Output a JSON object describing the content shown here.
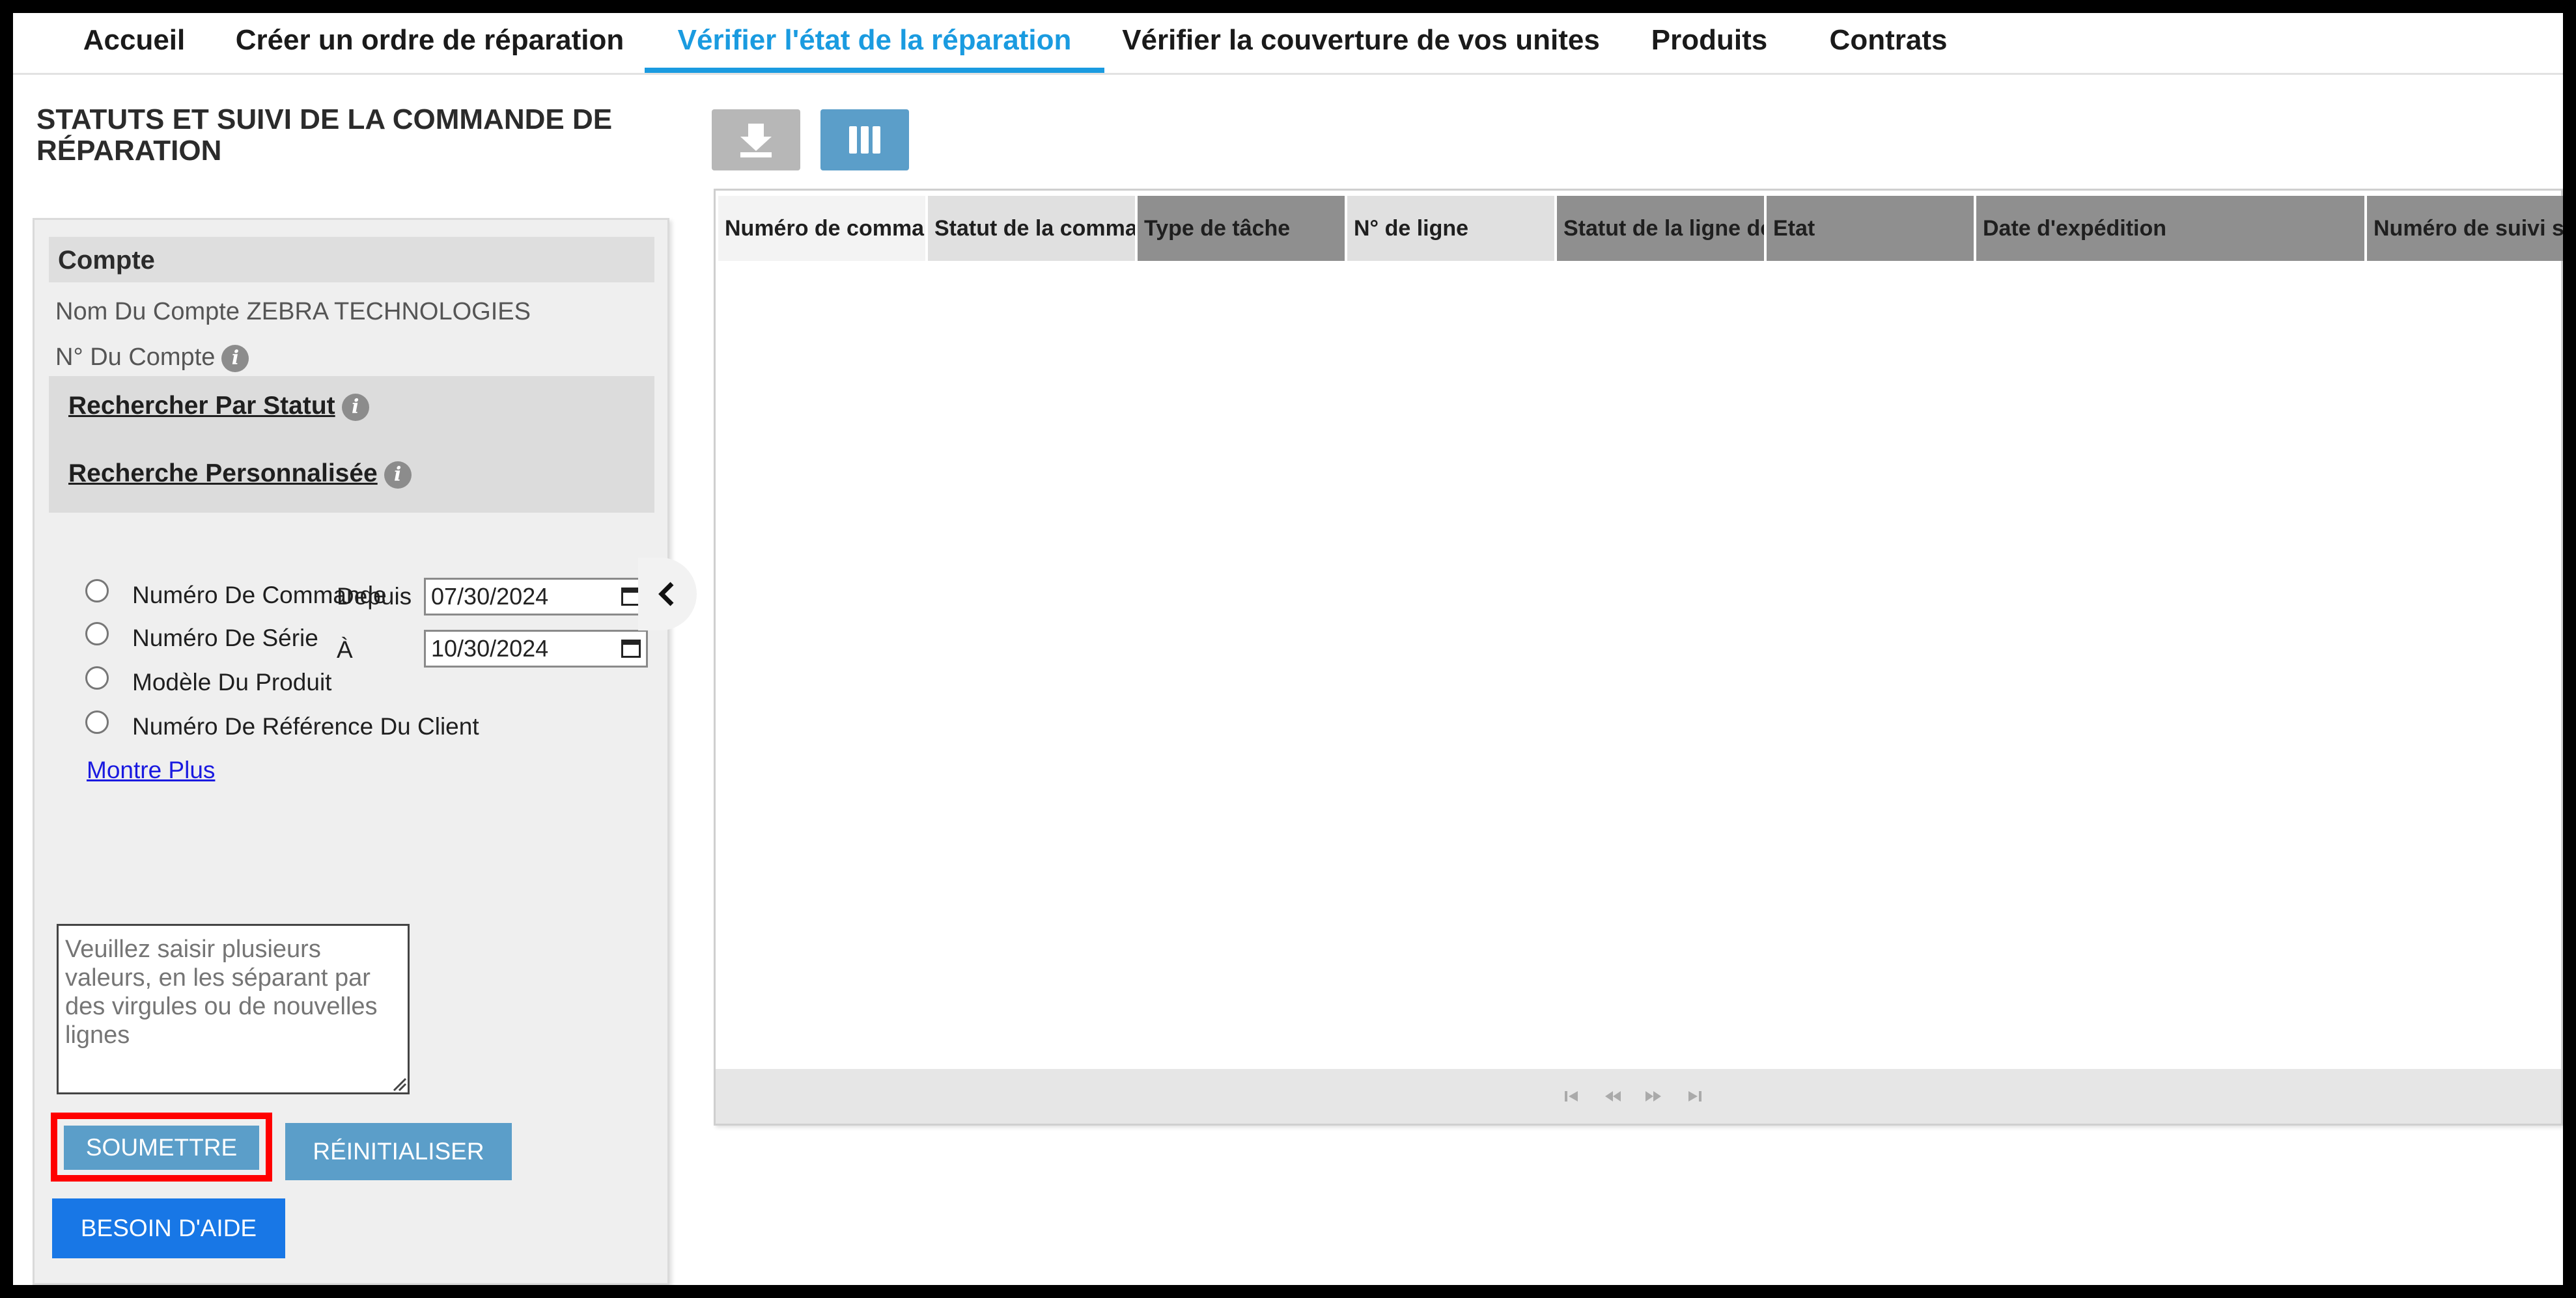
{
  "nav": {
    "tabs": [
      {
        "label": "Accueil"
      },
      {
        "label": "Créer un ordre de réparation"
      },
      {
        "label": "Vérifier l'état de la réparation",
        "active": true
      },
      {
        "label": "Vérifier la couverture de vos unites"
      },
      {
        "label": "Produits"
      },
      {
        "label": "Contrats"
      }
    ]
  },
  "page": {
    "title_line1": "STATUTS ET SUIVI DE LA COMMANDE DE",
    "title_line2": "RÉPARATION"
  },
  "account": {
    "section_label": "Compte",
    "name_label": "Nom Du Compte",
    "name_value": "ZEBRA TECHNOLOGIES",
    "number_label": "N° Du Compte"
  },
  "search": {
    "by_status_label": "Rechercher Par Statut",
    "custom_label": "Recherche Personnalisée",
    "radio_options": [
      {
        "label": "Numéro De Commande"
      },
      {
        "label": "Numéro De Série"
      },
      {
        "label": "Modèle Du Produit"
      },
      {
        "label": "Numéro De Référence Du Client"
      }
    ],
    "from_label": "Depuis",
    "from_value": "07/30/2024",
    "to_label": "À",
    "to_value": "10/30/2024",
    "show_more_label": "Montre Plus",
    "values_placeholder": "Veuillez saisir plusieurs valeurs, en les séparant par des virgules ou de nouvelles lignes"
  },
  "buttons": {
    "submit": "SOUMETTRE",
    "reset": "RÉINITIALISER",
    "help": "BESOIN D'AIDE"
  },
  "toolbar": {
    "download_icon": "download-icon",
    "columns_icon": "columns-icon"
  },
  "grid": {
    "columns": [
      {
        "label": "Numéro de commande"
      },
      {
        "label": "Statut de la commande"
      },
      {
        "label": "Type de tâche"
      },
      {
        "label": "N° de ligne"
      },
      {
        "label": "Statut de la ligne de"
      },
      {
        "label": "Etat"
      },
      {
        "label": "Date d'expédition"
      },
      {
        "label": "Numéro de suivi s"
      }
    ],
    "rows": []
  },
  "colors": {
    "accent": "#1a9be0",
    "button": "#5b9ec9",
    "help_button": "#1877e6",
    "highlight": "#ff0000"
  }
}
